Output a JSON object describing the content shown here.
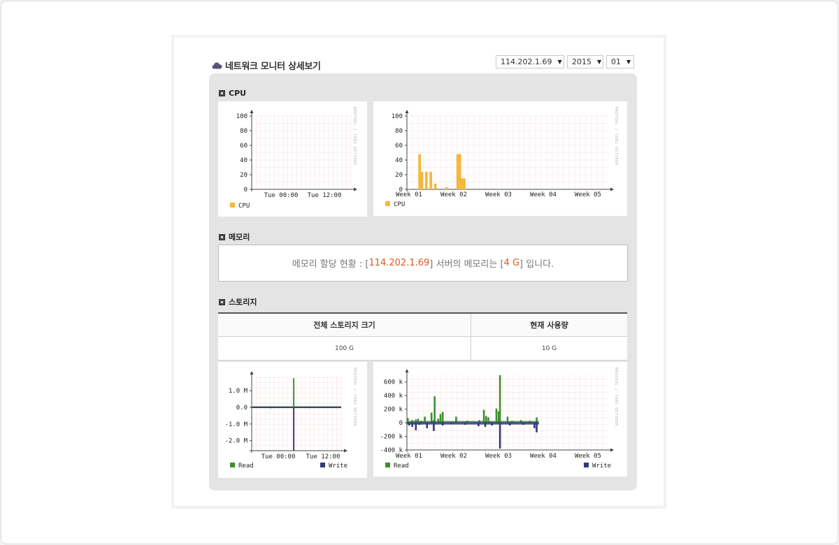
{
  "page": {
    "title": "네트워크 모니터 상세보기",
    "icon": "cloud-icon"
  },
  "filters": {
    "server": "114.202.1.69",
    "year": "2015",
    "month": "01"
  },
  "colors": {
    "cpu": "#f5b83a",
    "read": "#3f8f2e",
    "write": "#2f3a7a",
    "highlight": "#e2571e",
    "grid": "#f2c4c4"
  },
  "cpu": {
    "heading": "CPU",
    "watermark": "RRDTOOL / TOBI OETIKER"
  },
  "memory": {
    "heading": "메모리",
    "prefix": "메모리 할당 현황 : [",
    "server": "114.202.1.69",
    "middle": "] 서버의 메모리는 [",
    "size": "4 G",
    "suffix": "] 입니다."
  },
  "storage": {
    "heading": "스토리지",
    "columns": [
      "전체 스토리지 크기",
      "현재 사용량"
    ],
    "values": [
      "100 G",
      "10 G"
    ]
  },
  "chart_data": [
    {
      "type": "bar",
      "title": "",
      "x_ticks": [
        "Tue 00:00",
        "Tue 12:00"
      ],
      "ylim": [
        0,
        100
      ],
      "y_ticks": [
        "100",
        "80",
        "60",
        "40",
        "20",
        "0"
      ],
      "series": [
        {
          "name": "CPU",
          "values": []
        }
      ],
      "grid": true,
      "legend": "bottom-left"
    },
    {
      "type": "bar",
      "title": "",
      "x_ticks": [
        "Week 01",
        "Week 02",
        "Week 03",
        "Week 04",
        "Week 05"
      ],
      "ylim": [
        0,
        100
      ],
      "y_ticks": [
        "100",
        "80",
        "60",
        "40",
        "20",
        "0"
      ],
      "series": [
        {
          "name": "CPU",
          "points": [
            {
              "week": 0.05,
              "value": 48
            },
            {
              "week": 0.1,
              "value": 24
            },
            {
              "week": 0.2,
              "value": 24
            },
            {
              "week": 0.3,
              "value": 24
            },
            {
              "week": 0.4,
              "value": 8
            },
            {
              "week": 0.65,
              "value": 3
            },
            {
              "week": 0.9,
              "value": 48
            },
            {
              "week": 0.95,
              "value": 48
            },
            {
              "week": 1.0,
              "value": 15
            },
            {
              "week": 1.05,
              "value": 15
            }
          ]
        }
      ],
      "grid": true,
      "legend": "bottom-left"
    },
    {
      "type": "line",
      "title": "",
      "x_ticks": [
        "Tue 00:00",
        "Tue 12:00"
      ],
      "ylim": [
        -2.6,
        1.8
      ],
      "y_ticks": [
        "1.0 M",
        "0.0",
        "-1.0 M",
        "-2.0 M"
      ],
      "series": [
        {
          "name": "Read",
          "spikes": [
            {
              "x": 0.47,
              "value": 1.75
            }
          ]
        },
        {
          "name": "Write",
          "spikes": [
            {
              "x": 0.47,
              "value": -2.8
            }
          ]
        }
      ],
      "grid": true,
      "legend": "bottom"
    },
    {
      "type": "bar",
      "title": "",
      "x_ticks": [
        "Week 01",
        "Week 02",
        "Week 03",
        "Week 04",
        "Week 05"
      ],
      "ylim": [
        -400,
        700
      ],
      "y_ticks": [
        "600 k",
        "400 k",
        "200 k",
        "0",
        "-200 k",
        "-400 k"
      ],
      "series": [
        {
          "name": "Read",
          "points": [
            {
              "week": 0.02,
              "value": 70
            },
            {
              "week": 0.12,
              "value": 40
            },
            {
              "week": 0.2,
              "value": 50
            },
            {
              "week": 0.25,
              "value": 60
            },
            {
              "week": 0.32,
              "value": 30
            },
            {
              "week": 0.4,
              "value": 90
            },
            {
              "week": 0.55,
              "value": 150
            },
            {
              "week": 0.6,
              "value": 40
            },
            {
              "week": 0.62,
              "value": 390
            },
            {
              "week": 0.7,
              "value": 60
            },
            {
              "week": 0.75,
              "value": 130
            },
            {
              "week": 0.8,
              "value": 160
            },
            {
              "week": 1.1,
              "value": 90
            },
            {
              "week": 1.35,
              "value": 30
            },
            {
              "week": 1.62,
              "value": 40
            },
            {
              "week": 1.72,
              "value": 190
            },
            {
              "week": 1.77,
              "value": 100
            },
            {
              "week": 1.82,
              "value": 80
            },
            {
              "week": 2.0,
              "value": 210
            },
            {
              "week": 2.05,
              "value": 170
            },
            {
              "week": 2.08,
              "value": 700
            },
            {
              "week": 2.25,
              "value": 90
            },
            {
              "week": 2.35,
              "value": 30
            },
            {
              "week": 2.55,
              "value": 40
            },
            {
              "week": 2.75,
              "value": 30
            },
            {
              "week": 2.9,
              "value": 80
            }
          ]
        },
        {
          "name": "Write",
          "points": [
            {
              "week": 0.05,
              "value": -40
            },
            {
              "week": 0.12,
              "value": -60
            },
            {
              "week": 0.2,
              "value": -110
            },
            {
              "week": 0.28,
              "value": -30
            },
            {
              "week": 0.45,
              "value": -80
            },
            {
              "week": 0.6,
              "value": -120
            },
            {
              "week": 0.8,
              "value": -40
            },
            {
              "week": 1.0,
              "value": -20
            },
            {
              "week": 1.3,
              "value": -30
            },
            {
              "week": 1.6,
              "value": -50
            },
            {
              "week": 1.75,
              "value": -60
            },
            {
              "week": 1.9,
              "value": -40
            },
            {
              "week": 2.08,
              "value": -380
            },
            {
              "week": 2.3,
              "value": -40
            },
            {
              "week": 2.6,
              "value": -30
            },
            {
              "week": 2.85,
              "value": -80
            },
            {
              "week": 2.9,
              "value": -140
            }
          ]
        }
      ],
      "grid": true,
      "legend": "bottom"
    }
  ]
}
